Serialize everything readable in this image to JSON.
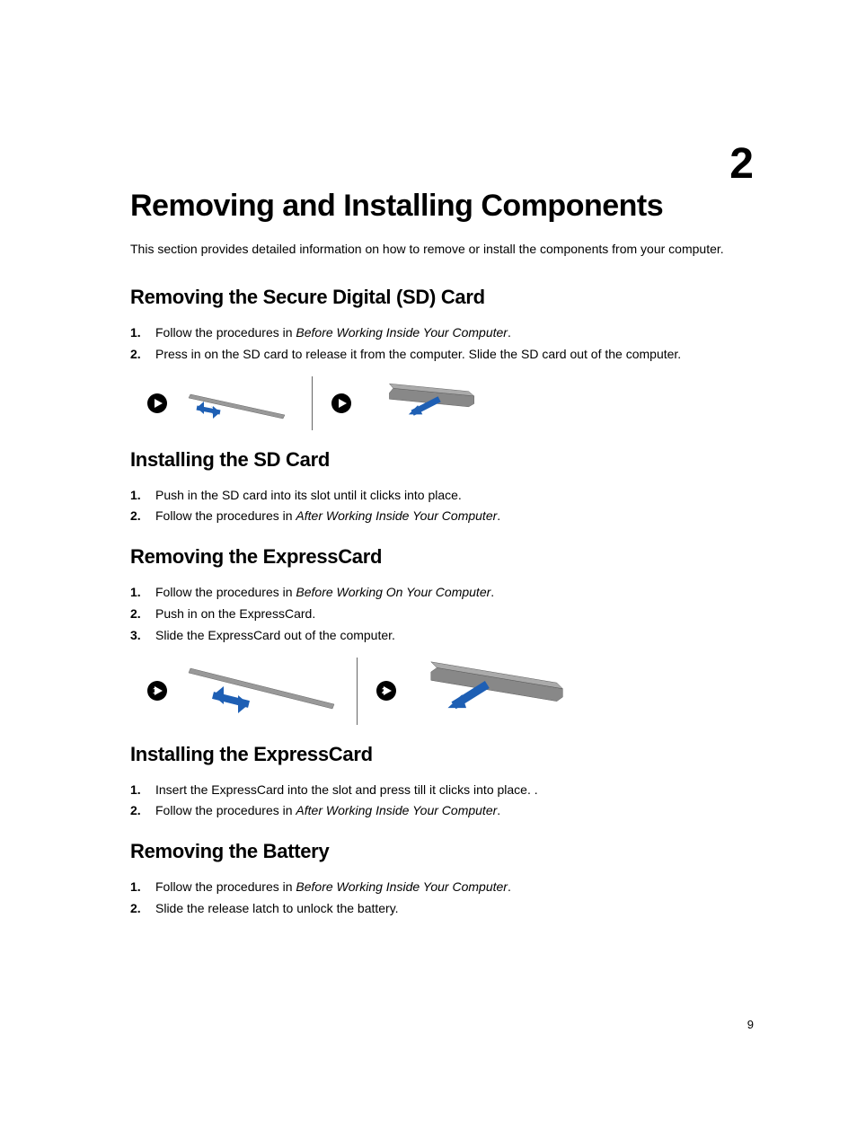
{
  "chapter": {
    "number": "2",
    "title": "Removing and Installing Components",
    "intro": "This section provides detailed information on how to remove or install the components from your computer."
  },
  "sections": [
    {
      "heading": "Removing the Secure Digital (SD) Card",
      "steps": [
        {
          "prefix": "Follow the procedures in ",
          "italic": "Before Working Inside Your Computer",
          "suffix": "."
        },
        {
          "prefix": "Press in on the SD card to release it from the computer. Slide the SD card out of the computer.",
          "italic": "",
          "suffix": ""
        }
      ],
      "has_figure": true,
      "figure_type": "sd"
    },
    {
      "heading": "Installing the SD Card",
      "steps": [
        {
          "prefix": "Push in the SD card into its slot until it clicks into place.",
          "italic": "",
          "suffix": ""
        },
        {
          "prefix": "Follow the procedures in ",
          "italic": "After Working Inside Your Computer",
          "suffix": "."
        }
      ],
      "has_figure": false
    },
    {
      "heading": "Removing the ExpressCard",
      "steps": [
        {
          "prefix": "Follow the procedures in ",
          "italic": "Before Working On Your Computer",
          "suffix": "."
        },
        {
          "prefix": "Push in on the ExpressCard.",
          "italic": "",
          "suffix": ""
        },
        {
          "prefix": "Slide the ExpressCard out of the computer.",
          "italic": "",
          "suffix": ""
        }
      ],
      "has_figure": true,
      "figure_type": "express"
    },
    {
      "heading": "Installing the ExpressCard",
      "steps": [
        {
          "prefix": "Insert the ExpressCard into the slot and press till it clicks into place. .",
          "italic": "",
          "suffix": ""
        },
        {
          "prefix": "Follow the procedures in ",
          "italic": "After Working Inside Your Computer",
          "suffix": "."
        }
      ],
      "has_figure": false
    },
    {
      "heading": "Removing the Battery",
      "steps": [
        {
          "prefix": "Follow the procedures in ",
          "italic": "Before Working Inside Your Computer",
          "suffix": "."
        },
        {
          "prefix": "Slide the release latch to unlock the battery.",
          "italic": "",
          "suffix": ""
        }
      ],
      "has_figure": false
    }
  ],
  "page_number": "9",
  "icons": {
    "play": "play-icon"
  }
}
